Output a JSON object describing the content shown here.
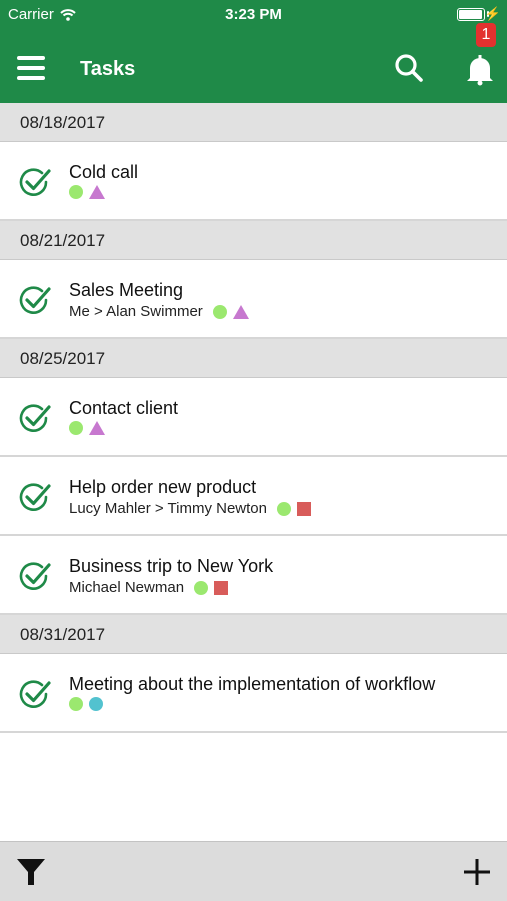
{
  "status_bar": {
    "carrier": "Carrier",
    "time": "3:23 PM"
  },
  "navbar": {
    "title": "Tasks",
    "notification_count": "1"
  },
  "sections": [
    {
      "date": "08/18/2017",
      "tasks": [
        {
          "title": "Cold call",
          "people": "",
          "markers": [
            "green-dot",
            "purple-triangle"
          ]
        }
      ]
    },
    {
      "date": "08/21/2017",
      "tasks": [
        {
          "title": "Sales Meeting",
          "people": "Me > Alan Swimmer",
          "markers": [
            "green-dot",
            "purple-triangle"
          ]
        }
      ]
    },
    {
      "date": "08/25/2017",
      "tasks": [
        {
          "title": "Contact client",
          "people": "",
          "markers": [
            "green-dot",
            "purple-triangle"
          ]
        },
        {
          "title": "Help order new product",
          "people": "Lucy Mahler > Timmy Newton",
          "markers": [
            "green-dot",
            "red-square"
          ]
        },
        {
          "title": "Business trip to New York",
          "people": "Michael Newman",
          "markers": [
            "green-dot",
            "red-square"
          ]
        }
      ]
    },
    {
      "date": "08/31/2017",
      "tasks": [
        {
          "title": "Meeting about the implementation of workflow",
          "people": "",
          "markers": [
            "green-dot",
            "teal-dot"
          ]
        }
      ]
    }
  ],
  "colors": {
    "header": "#1f8a48",
    "check": "#1f8a48",
    "badge": "#e3312f"
  },
  "icons": {
    "menu": "hamburger-icon",
    "search": "search-icon",
    "notifications": "bell-icon",
    "filter": "filter-icon",
    "add": "plus-icon",
    "complete": "check-circle-icon"
  }
}
